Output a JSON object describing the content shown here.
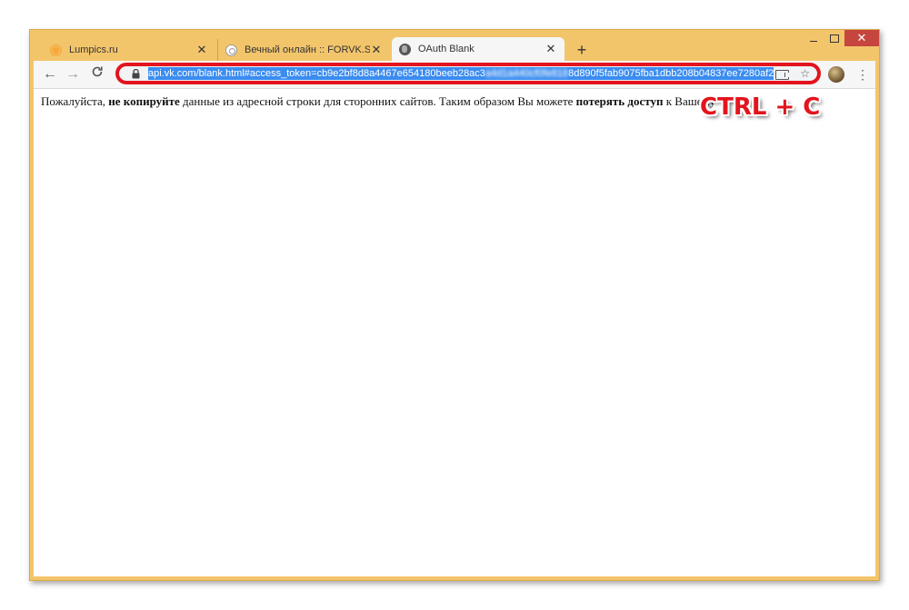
{
  "window": {
    "controls": {
      "minimize": "minimize",
      "maximize": "maximize",
      "close": "✕"
    }
  },
  "tabs": [
    {
      "title": "Lumpics.ru",
      "icon": "lumpics-favicon-icon",
      "close": "✕"
    },
    {
      "title": "Вечный онлайн :: FORVK.SPACE",
      "icon": "forvk-favicon-icon",
      "close": "✕"
    },
    {
      "title": "OAuth Blank",
      "icon": "globe-icon",
      "close": "✕",
      "active": true
    }
  ],
  "new_tab": "+",
  "toolbar": {
    "back": "←",
    "forward": "→",
    "reload": "C",
    "url_visible_start": "api.vk.com/blank.html#access_token=cb9e2bf8d8a4467e654180beeb28ac3",
    "url_blurred": "a4d1a440cf0fe818",
    "url_visible_end": "8d890f5fab9075fba1dbb208b04837ee7280af2",
    "bookmark_star": "☆",
    "menu": "⋮"
  },
  "page": {
    "notice_part1": "Пожалуйста, ",
    "notice_bold1": "не копируйте",
    "notice_part2": " данные из адресной строки для сторонних сайтов. Таким образом Вы можете ",
    "notice_bold2": "потерять доступ",
    "notice_part3": " к Вашему"
  },
  "overlay": {
    "shortcut": "CTRL + C"
  },
  "colors": {
    "window_frame": "#f3c56b",
    "highlight_border": "#e3141d",
    "selection": "#3b8cf0"
  }
}
